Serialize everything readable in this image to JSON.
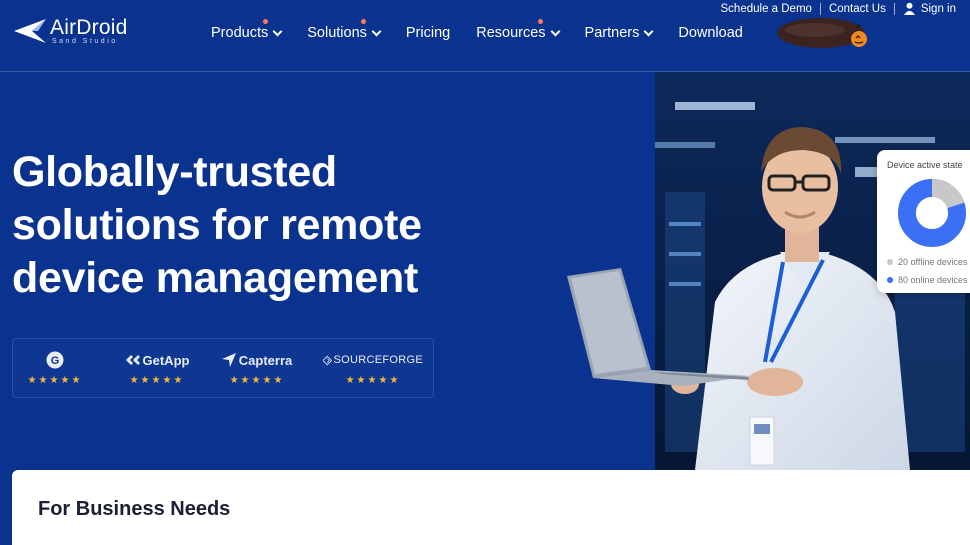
{
  "brand": {
    "name": "AirDroid",
    "sub": "Sand Studio"
  },
  "nav": {
    "items": [
      {
        "label": "Products",
        "dropdown": true,
        "dot": true
      },
      {
        "label": "Solutions",
        "dropdown": true,
        "dot": true
      },
      {
        "label": "Pricing",
        "dropdown": false,
        "dot": false
      },
      {
        "label": "Resources",
        "dropdown": true,
        "dot": true
      },
      {
        "label": "Partners",
        "dropdown": true,
        "dot": false
      },
      {
        "label": "Download",
        "dropdown": false,
        "dot": false
      }
    ]
  },
  "utility": {
    "schedule_demo": "Schedule a Demo",
    "contact_us": "Contact Us",
    "sign_in": "Sign in"
  },
  "hero": {
    "headline_line1": "Globally-trusted",
    "headline_line2": "solutions for remote",
    "headline_line3": "device management"
  },
  "ratings": [
    {
      "name": "G2",
      "stars": 4.5,
      "star_glyphs": "★★★★★"
    },
    {
      "name": "GetApp",
      "stars": 5,
      "star_glyphs": "★★★★★"
    },
    {
      "name": "Capterra",
      "stars": 5,
      "star_glyphs": "★★★★★"
    },
    {
      "name": "SOURCEFORGE",
      "stars": 5,
      "star_glyphs": "★★★★★"
    }
  ],
  "device_card": {
    "title": "Device active state",
    "offline_label": "20 offline devices",
    "online_label": "80 online devices",
    "offline_count": 20,
    "online_count": 80,
    "offline_color": "#c8c8c8",
    "online_color": "#3b6ff5"
  },
  "section": {
    "heading": "For Business Needs"
  },
  "colors": {
    "primary_bg": "#0a3390",
    "accent_dot": "#ff7a59",
    "star": "#f5b63a"
  }
}
